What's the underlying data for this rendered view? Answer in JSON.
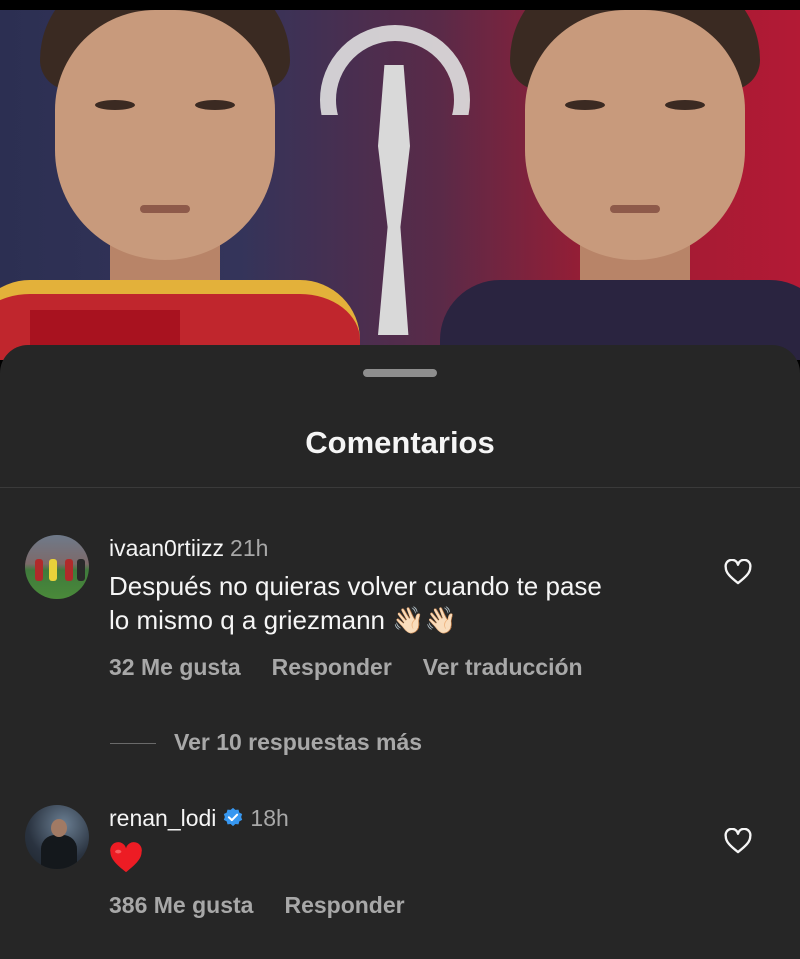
{
  "sheet": {
    "title": "Comentarios"
  },
  "comments": [
    {
      "username": "ivaan0rtiizz",
      "time": "21h",
      "text_line1": "Después no quieras volver cuando te pase",
      "text_line2": "lo mismo q a griezmann",
      "emoji": "👋🏻👋🏻",
      "likes": "32 Me gusta",
      "reply": "Responder",
      "translate": "Ver traducción",
      "view_replies": "Ver 10 respuestas más"
    },
    {
      "username": "renan_lodi",
      "verified": true,
      "time": "18h",
      "likes": "386 Me gusta",
      "reply": "Responder"
    }
  ],
  "colors": {
    "sheet_bg": "#262626",
    "primary_text": "#f5f5f5",
    "secondary_text": "#a8a8a8",
    "verified_badge": "#3797f0",
    "heart_red": "#ed1c24"
  },
  "icons": {
    "like": "heart-outline-icon",
    "verified": "verified-badge-icon",
    "reaction": "red-heart-icon"
  }
}
